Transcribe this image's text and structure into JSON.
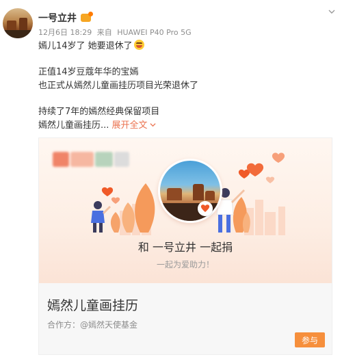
{
  "post": {
    "author": "一号立井",
    "time": "12月6日 18:29",
    "via_prefix": "来自",
    "device": "HUAWEI P40 Pro 5G",
    "lines": [
      "嫣儿14岁了  她要退休了",
      "正值14岁豆蔻年华的宝嫣",
      "也正式从嫣然儿童画挂历项目光荣退休了",
      "持续了7年的嫣然经典保留项目",
      "嫣然儿童画挂历..."
    ],
    "expand_label": "展开全文"
  },
  "card": {
    "slogan": "和  一号立井  一起捐",
    "sub_slogan": "一起为爱助力！",
    "title": "嫣然儿童画挂历",
    "partner": "合作方：@嫣然天使基金",
    "join_label": "参与"
  },
  "colors": {
    "accent": "#eb7350",
    "join_button": "#f68f3c",
    "heart": "#f05a28"
  }
}
